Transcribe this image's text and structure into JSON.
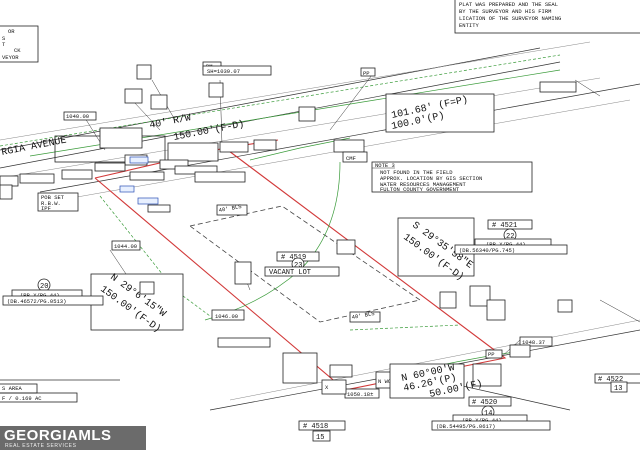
{
  "survey": {
    "street_name": "RGIA AVENUE",
    "row_width": "40' R/W",
    "street_bearing": "150.00'(F-D)",
    "top_note": [
      "PLAT WAS PREPARED AND THE SEAL",
      "BY THE SURVEYOR AND HIS FIRM",
      "LICATION OF THE SURVEYOR NAMING",
      "ENTITY"
    ],
    "top_left_box": [
      "OR",
      "S",
      "T",
      "CK",
      "VEYOR"
    ],
    "bm_label": "BM",
    "elevation_label": "SH=1039.07",
    "pp_labels": [
      "PP",
      "PP",
      "PP"
    ],
    "elev_1040": "1040.00",
    "elev_1044": "1044.00",
    "elev_1046": "1046.00",
    "elev_1048": "1048.37",
    "elev_1050": "1050.18±",
    "top_bearing_1": "101.68' (F=P)",
    "top_bearing_2": "100.0'(P)",
    "note3": {
      "title": "NOTE 3",
      "lines": [
        "NOT FOUND IN THE FIELD",
        "APPROX. LOCATION BY GIS SECTION",
        "WATER RESOURCES MANAGEMENT",
        "FULTON COUNTY GOVERNMENT"
      ]
    },
    "east_bearing": "S 29°35'58\"E",
    "east_length": "150.00'(F-D)",
    "west_bearing": "N 29°6'15\"W",
    "west_length": "150.00'(F-D)",
    "lot_4519": "# 4519",
    "vacant_lot": "VACANT LOT",
    "lot_23": "23",
    "lot_4521": "# 4521",
    "lot_22": "22",
    "plat_ref_22": "(PB.X/PG.44)",
    "deed_ref_22": "(DB.56340/PG.745)",
    "lot_20": "20",
    "plat_ref_20": "(PB.X/PG.44)",
    "deed_ref_20": "(DB.46572/PG.0513)",
    "lot_4520": "# 4520",
    "lot_14": "14",
    "plat_ref_14": "(PB.X/PG.44)",
    "deed_ref_14": "(DB.54495/PG.0617)",
    "lot_4518": "# 4518",
    "lot_15": "15",
    "lot_4522": "# 4522",
    "lot_13": "13",
    "area_label": "S AREA",
    "area_value": "F / 0.169 AC",
    "bottom_bearing": "N 60°00'W",
    "bottom_length": "46.26'(P)",
    "bottom_length_2": "50.00'(F)",
    "fence_labels": [
      "40' BLS",
      "40' BLS",
      "X",
      "N WOOD"
    ],
    "pob_labels": [
      "POB SET",
      "R.B.W.",
      "IPF"
    ],
    "small_tags": [
      "SSMH",
      "CMF",
      "WM",
      "GV",
      "OHW"
    ]
  },
  "logo": {
    "name": "GEORGIAMLS",
    "tagline": "REAL ESTATE SERVICES"
  }
}
